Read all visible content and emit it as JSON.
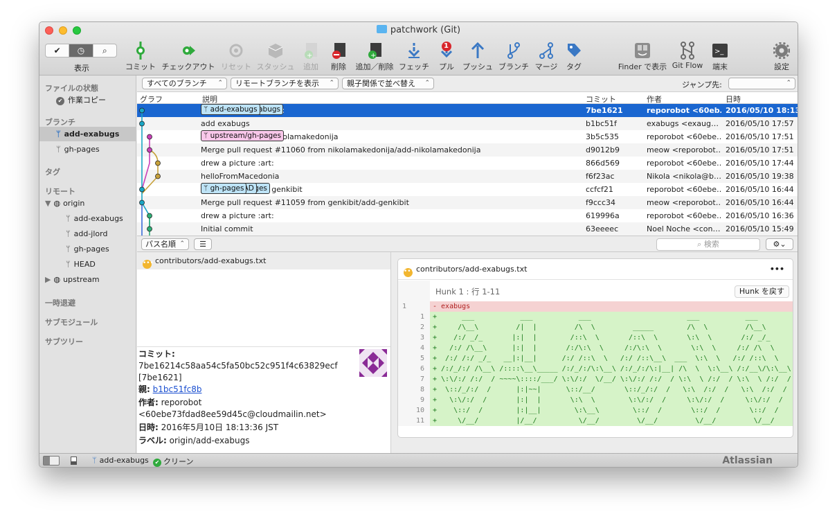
{
  "window": {
    "title": "patchwork (Git)"
  },
  "toolbar": {
    "view_label": "表示",
    "buttons": [
      {
        "label": "コミット"
      },
      {
        "label": "チェックアウト"
      },
      {
        "label": "リセット"
      },
      {
        "label": "スタッシュ"
      },
      {
        "label": "追加"
      },
      {
        "label": "削除"
      },
      {
        "label": "追加／削除"
      },
      {
        "label": "フェッチ"
      },
      {
        "label": "プル",
        "badge": "1"
      },
      {
        "label": "プッシュ"
      },
      {
        "label": "ブランチ"
      },
      {
        "label": "マージ"
      },
      {
        "label": "タグ"
      },
      {
        "label": "Finder で表示"
      },
      {
        "label": "Git Flow"
      },
      {
        "label": "端末"
      },
      {
        "label": "設定"
      }
    ]
  },
  "sidebar": {
    "file_status_header": "ファイルの状態",
    "working_copy": "作業コピー",
    "branches_header": "ブランチ",
    "branches": [
      "add-exabugs",
      "gh-pages"
    ],
    "tags_header": "タグ",
    "remotes_header": "リモート",
    "remote_origin": "origin",
    "origin_branches": [
      "add-exabugs",
      "add-jlord",
      "gh-pages",
      "HEAD"
    ],
    "remote_upstream": "upstream",
    "stashes_header": "一時退避",
    "submodules_header": "サブモジュール",
    "subtrees_header": "サブツリー"
  },
  "filters": {
    "branches": "すべてのブランチ",
    "remote": "リモートブランチを表示",
    "order": "親子関係で並べ替え",
    "jump_label": "ジャンプ先:"
  },
  "columns": {
    "graph": "グラフ",
    "description": "説明",
    "commit": "コミット",
    "author": "作者",
    "date": "日時"
  },
  "commits": [
    {
      "tags": [
        {
          "name": "origin/add-exabugs"
        },
        {
          "name": "add-exabugs"
        }
      ],
      "message": "drew a picture :art:",
      "hash": "7be1621",
      "author": "reporobot <60eb…",
      "date": "2016/05/10 18:13"
    },
    {
      "tags": [],
      "message": "add exabugs",
      "hash": "b1bc51f",
      "author": "exabugs <exaug…",
      "date": "2016/05/10 17:57"
    },
    {
      "tags": [
        {
          "name": "upstream/gh-pages",
          "pink": true
        }
      ],
      "message": "Rebuilt index with nikolamakedonija",
      "hash": "3b5c535",
      "author": "reporobot <60ebe…",
      "date": "2016/05/10 17:51"
    },
    {
      "tags": [],
      "message": "Merge pull request #11060 from nikolamakedonija/add-nikolamakedonija",
      "hash": "d9012b9",
      "author": "meow <reporobot…",
      "date": "2016/05/10 17:51"
    },
    {
      "tags": [],
      "message": "drew a picture :art:",
      "hash": "866d569",
      "author": "reporobot <60ebe…",
      "date": "2016/05/10 17:44"
    },
    {
      "tags": [],
      "message": "helloFromMacedonia",
      "hash": "f6f23ac",
      "author": "Nikola <nikola@b…",
      "date": "2016/05/10 19:38"
    },
    {
      "tags": [
        {
          "name": "origin/gh-pages"
        },
        {
          "name": "origin/HEAD"
        },
        {
          "name": "gh-pages"
        }
      ],
      "message": "Rebuilt index with genkibit",
      "hash": "ccfcf21",
      "author": "reporobot <60ebe…",
      "date": "2016/05/10 16:44"
    },
    {
      "tags": [],
      "message": "Merge pull request #11059 from genkibit/add-genkibit",
      "hash": "f9ccc34",
      "author": "meow <reporobot…",
      "date": "2016/05/10 16:44"
    },
    {
      "tags": [],
      "message": "drew a picture :art:",
      "hash": "619996a",
      "author": "reporobot <60ebe…",
      "date": "2016/05/10 16:36"
    },
    {
      "tags": [],
      "message": "Initial commit",
      "hash": "63eeeec",
      "author": "Noel Noche <con…",
      "date": "2016/05/10 15:49"
    }
  ],
  "lower_toolbar": {
    "sort": "パス名順",
    "search_placeholder": "検索"
  },
  "file": {
    "name": "contributors/add-exabugs.txt"
  },
  "commit_info": {
    "commit_label": "コミット:",
    "commit_hash": "7be16214c58aa54c5fa50bc52c951f4c63829ecf",
    "commit_short": "[7be1621]",
    "parent_label": "親:",
    "parent": "b1bc51fc8b",
    "author_label": "作者:",
    "author": "reporobot <60ebe73fdad8ee59d45c@cloudmailin.net>",
    "date_label": "日時:",
    "date": "2016年5月10日 18:13:36 JST",
    "labels_label": "ラベル:",
    "labels": "origin/add-exabugs"
  },
  "diff": {
    "file": "contributors/add-exabugs.txt",
    "more": "•••",
    "hunk": "Hunk 1 : 行 1-11",
    "revert": "Hunk を戻す",
    "lines": [
      {
        "type": "del",
        "old": "1",
        "new": "",
        "text": "- exabugs"
      },
      {
        "type": "add",
        "old": "",
        "new": "1",
        "text": "+      ___           ___           ___                       ___           ___"
      },
      {
        "type": "add",
        "old": "",
        "new": "2",
        "text": "+     /\\__\\         /|  |         /\\  \\         _____        /\\  \\         /\\__\\"
      },
      {
        "type": "add",
        "old": "",
        "new": "3",
        "text": "+    /:/ _/_       |:|  |        /::\\  \\       /::\\  \\       \\:\\  \\       /:/ _/_"
      },
      {
        "type": "add",
        "old": "",
        "new": "4",
        "text": "+   /:/ /\\__\\      |:|  |       /:/\\:\\  \\     /:/\\:\\  \\       \\:\\  \\     /:/ /\\  \\"
      },
      {
        "type": "add",
        "old": "",
        "new": "5",
        "text": "+  /:/ /:/ _/_   __|:|__|      /:/ /::\\  \\   /:/ /::\\__\\  ___  \\:\\  \\   /:/ /::\\  \\"
      },
      {
        "type": "add",
        "old": "",
        "new": "6",
        "text": "+ /:/_/:/ /\\__\\ /::::\\__\\_____ /:/_/:/\\:\\__\\ /:/_/:/\\:|__| /\\  \\  \\:\\__\\ /:/__\\/\\:\\__\\"
      },
      {
        "type": "add",
        "old": "",
        "new": "7",
        "text": "+ \\:\\/:/ /:/  / ~~~~\\::::/___/ \\:\\/:/  \\/__/ \\:\\/:/ /:/  / \\:\\  \\ /:/  / \\:\\  \\ /:/  /"
      },
      {
        "type": "add",
        "old": "",
        "new": "8",
        "text": "+  \\::/_/:/  /      |:|~~|      \\::/__/       \\::/_/:/  /   \\:\\  /:/  /   \\:\\  /:/  /"
      },
      {
        "type": "add",
        "old": "",
        "new": "9",
        "text": "+   \\:\\/:/  /       |:|  |       \\:\\  \\        \\:\\/:/  /     \\:\\/:/  /     \\:\\/:/  /"
      },
      {
        "type": "add",
        "old": "",
        "new": "10",
        "text": "+    \\::/  /        |:|__|        \\:\\__\\        \\::/  /       \\::/  /       \\::/  /"
      },
      {
        "type": "add",
        "old": "",
        "new": "11",
        "text": "+     \\/__/         |/__/          \\/__/         \\/__/         \\/__/         \\/__/"
      }
    ]
  },
  "statusbar": {
    "branch": "add-exabugs",
    "state": "クリーン",
    "brand": "Atlassian"
  }
}
